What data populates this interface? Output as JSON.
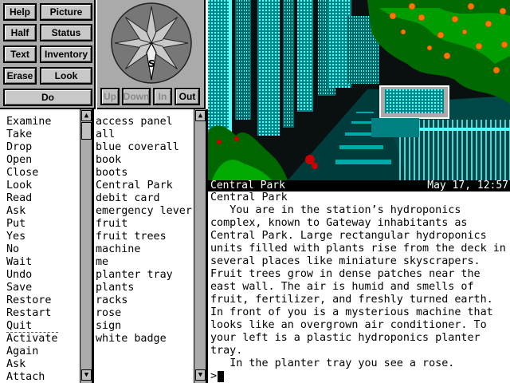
{
  "buttons": {
    "help": "Help",
    "picture": "Picture",
    "half": "Half",
    "status": "Status",
    "text": "Text",
    "inventory": "Inventory",
    "erase": "Erase",
    "look": "Look",
    "do": "Do"
  },
  "compass": {
    "heading": "S",
    "up": "Up",
    "down": "Down",
    "in": "In",
    "out": "Out",
    "enabled": {
      "up": false,
      "down": false,
      "in": false,
      "out": true
    }
  },
  "verbs": [
    "Examine",
    "Take",
    "Drop",
    "Open",
    "Close",
    "Look",
    "Read",
    "Ask",
    "Put",
    "Yes",
    "No",
    "Wait",
    "Undo",
    "Save",
    "Restore",
    "Restart",
    "Quit",
    "Activate",
    "Again",
    "Ask",
    "Attach"
  ],
  "verbs_separator_after": "Quit",
  "nouns": [
    "access panel",
    "all",
    "blue coverall",
    "book",
    "boots",
    "Central Park",
    "debit card",
    "emergency lever",
    "fruit",
    "fruit trees",
    "machine",
    "me",
    "planter tray",
    "plants",
    "racks",
    "rose",
    "sign",
    "white badge"
  ],
  "status": {
    "location": "Central Park",
    "datetime": "May 17, 12:57"
  },
  "narrative": {
    "heading": "Central Park",
    "paragraph1": "   You are in the station’s hydroponics complex, known to Gateway inhabitants as Central Park. Large rectangular hydroponics units filled with plants rise from the deck in several places like miniature skyscrapers. Fruit trees grow in dense patches near the east wall. The air is humid and smells of fruit, fertilizer, and freshly turned earth. In front of you is a mysterious machine that looks like an overgrown air conditioner. To your left is a plastic hydroponics planter tray.",
    "paragraph2": "   In the planter tray you see a rose."
  },
  "prompt": ">",
  "colors": {
    "panel_gray": "#aaaaaa",
    "button_face": "#c8c8c8",
    "scene_cyan": "#00aaaa",
    "scene_light_cyan": "#55ffff",
    "status_bar": "#000000"
  }
}
